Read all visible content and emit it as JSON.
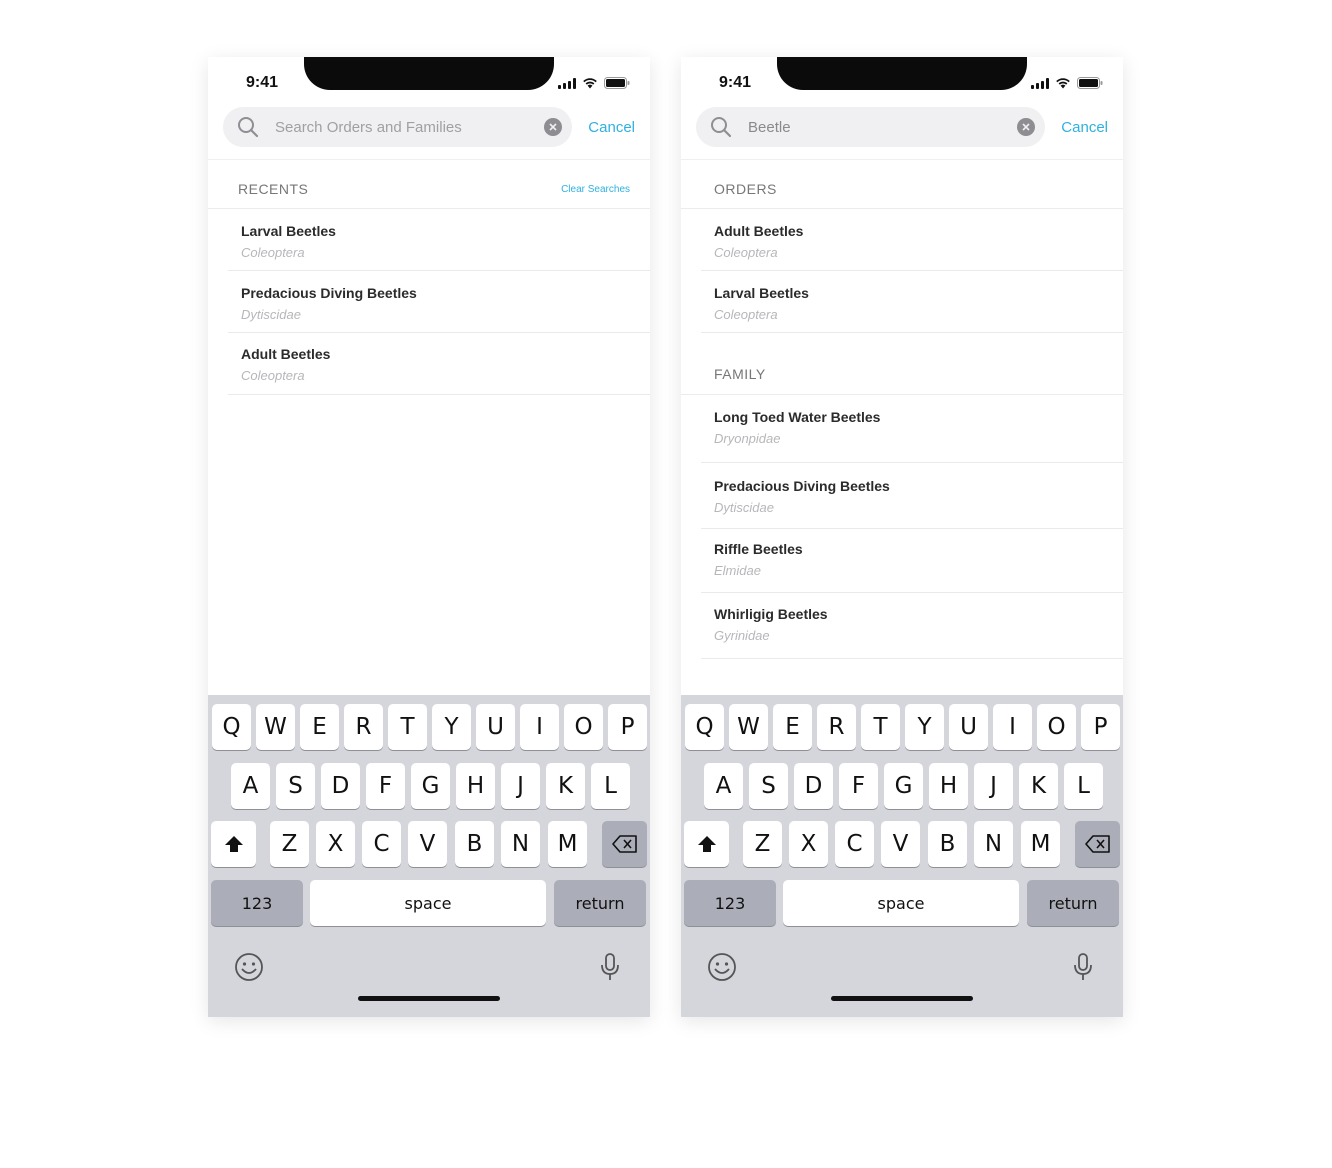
{
  "screens": [
    {
      "status": {
        "time": "9:41"
      },
      "search": {
        "value": "",
        "placeholder": "Search Orders and Families",
        "cancel_label": "Cancel"
      },
      "sections": [
        {
          "title": "RECENTS",
          "action_label": "Clear Searches",
          "items": [
            {
              "title": "Larval Beetles",
              "subtitle": "Coleoptera"
            },
            {
              "title": "Predacious Diving Beetles",
              "subtitle": "Dytiscidae"
            },
            {
              "title": "Adult Beetles",
              "subtitle": "Coleoptera"
            }
          ]
        }
      ]
    },
    {
      "status": {
        "time": "9:41"
      },
      "search": {
        "value": "Beetle",
        "placeholder": "Search Orders and Families",
        "cancel_label": "Cancel"
      },
      "sections": [
        {
          "title": "ORDERS",
          "items": [
            {
              "title": "Adult Beetles",
              "subtitle": "Coleoptera"
            },
            {
              "title": "Larval Beetles",
              "subtitle": "Coleoptera"
            }
          ]
        },
        {
          "title": "FAMILY",
          "items": [
            {
              "title": "Long Toed Water Beetles",
              "subtitle": "Dryonpidae"
            },
            {
              "title": "Predacious Diving Beetles",
              "subtitle": "Dytiscidae"
            },
            {
              "title": "Riffle Beetles",
              "subtitle": "Elmidae"
            },
            {
              "title": "Whirligig Beetles",
              "subtitle": "Gyrinidae"
            }
          ]
        }
      ]
    }
  ],
  "keyboard": {
    "row1": [
      "Q",
      "W",
      "E",
      "R",
      "T",
      "Y",
      "U",
      "I",
      "O",
      "P"
    ],
    "row2": [
      "A",
      "S",
      "D",
      "F",
      "G",
      "H",
      "J",
      "K",
      "L"
    ],
    "row3": [
      "Z",
      "X",
      "C",
      "V",
      "B",
      "N",
      "M"
    ],
    "numbers_label": "123",
    "space_label": "space",
    "return_label": "return",
    "shift_icon": "shift-icon",
    "delete_icon": "delete-icon",
    "emoji_icon": "emoji-icon",
    "mic_icon": "mic-icon"
  },
  "colors": {
    "accent": "#2fb1e0",
    "keyboard_bg": "#d4d6dc",
    "dark_key": "#abaeb8"
  }
}
